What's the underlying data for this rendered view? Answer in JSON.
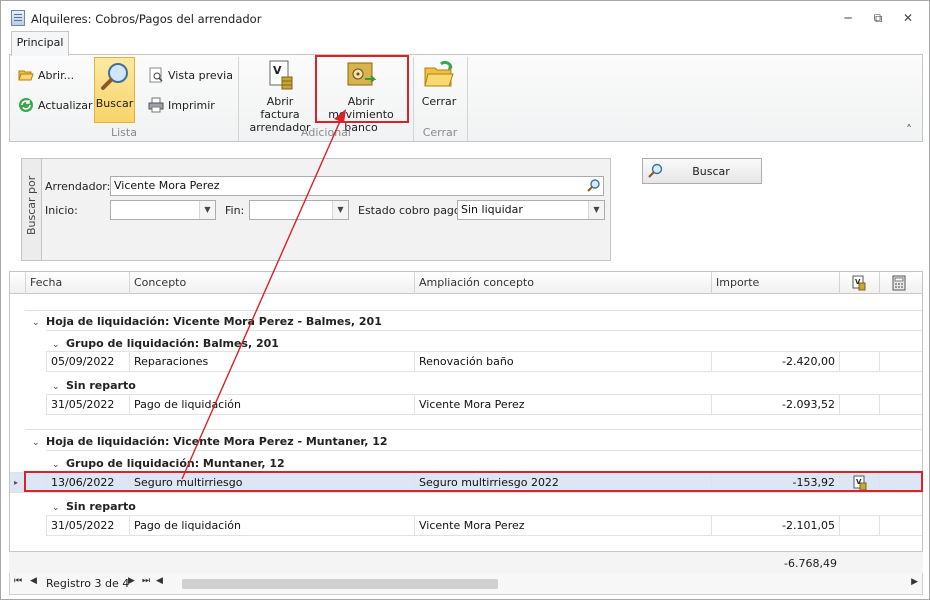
{
  "window": {
    "title": "Alquileres: Cobros/Pagos del arrendador",
    "minimize_glyph": "─",
    "restore_glyph": "⧉",
    "close_glyph": "✕"
  },
  "tabs": [
    {
      "label": "Principal"
    }
  ],
  "ribbon": {
    "groups": {
      "lista": "Lista",
      "adicional": "Adicional",
      "cerrar": "Cerrar"
    },
    "buttons": {
      "abrir": "Abrir...",
      "actualizar": "Actualizar",
      "buscar": "Buscar",
      "vista_previa": "Vista previa",
      "imprimir": "Imprimir",
      "abrir_factura_l1": "Abrir factura",
      "abrir_factura_l2": "arrendador",
      "abrir_movimiento_l1": "Abrir movimiento",
      "abrir_movimiento_l2": "banco",
      "cerrar": "Cerrar"
    },
    "collapse_glyph": "˄"
  },
  "filters": {
    "side_tab": "Buscar por",
    "arrendador_label": "Arrendador:",
    "arrendador_value": "Vicente Mora Perez",
    "inicio_label": "Inicio:",
    "inicio_value": "",
    "fin_label": "Fin:",
    "fin_value": "",
    "estado_label": "Estado cobro pago:",
    "estado_value": "Sin liquidar",
    "buscar_button": "Buscar"
  },
  "grid": {
    "columns": [
      "Fecha",
      "Concepto",
      "Ampliación concepto",
      "Importe"
    ],
    "groups": [
      {
        "title": "Hoja de liquidación: Vicente Mora Perez - Balmes, 201",
        "subgroups": [
          {
            "title": "Grupo de liquidación: Balmes, 201",
            "rows": [
              {
                "fecha": "05/09/2022",
                "concepto": "Reparaciones",
                "ampliacion": "Renovación baño",
                "importe": "-2.420,00"
              }
            ]
          },
          {
            "title": "Sin reparto",
            "rows": [
              {
                "fecha": "31/05/2022",
                "concepto": "Pago de liquidación",
                "ampliacion": "Vicente Mora Perez",
                "importe": "-2.093,52"
              }
            ]
          }
        ]
      },
      {
        "title": "Hoja de liquidación: Vicente Mora Perez - Muntaner, 12",
        "subgroups": [
          {
            "title": "Grupo de liquidación: Muntaner, 12",
            "rows": [
              {
                "fecha": "13/06/2022",
                "concepto": "Seguro multirriesgo",
                "ampliacion": "Seguro multirriesgo 2022",
                "importe": "-153,92",
                "selected": true
              }
            ]
          },
          {
            "title": "Sin reparto",
            "rows": [
              {
                "fecha": "31/05/2022",
                "concepto": "Pago de liquidación",
                "ampliacion": "Vicente Mora Perez",
                "importe": "-2.101,05"
              }
            ]
          }
        ]
      }
    ],
    "total": "-6.768,49"
  },
  "navigator": {
    "record_text": "Registro 3 de 4"
  },
  "colors": {
    "highlight_red": "#d8232a",
    "selection_bg": "#dce6f4",
    "active_button": "#f8d36a"
  }
}
